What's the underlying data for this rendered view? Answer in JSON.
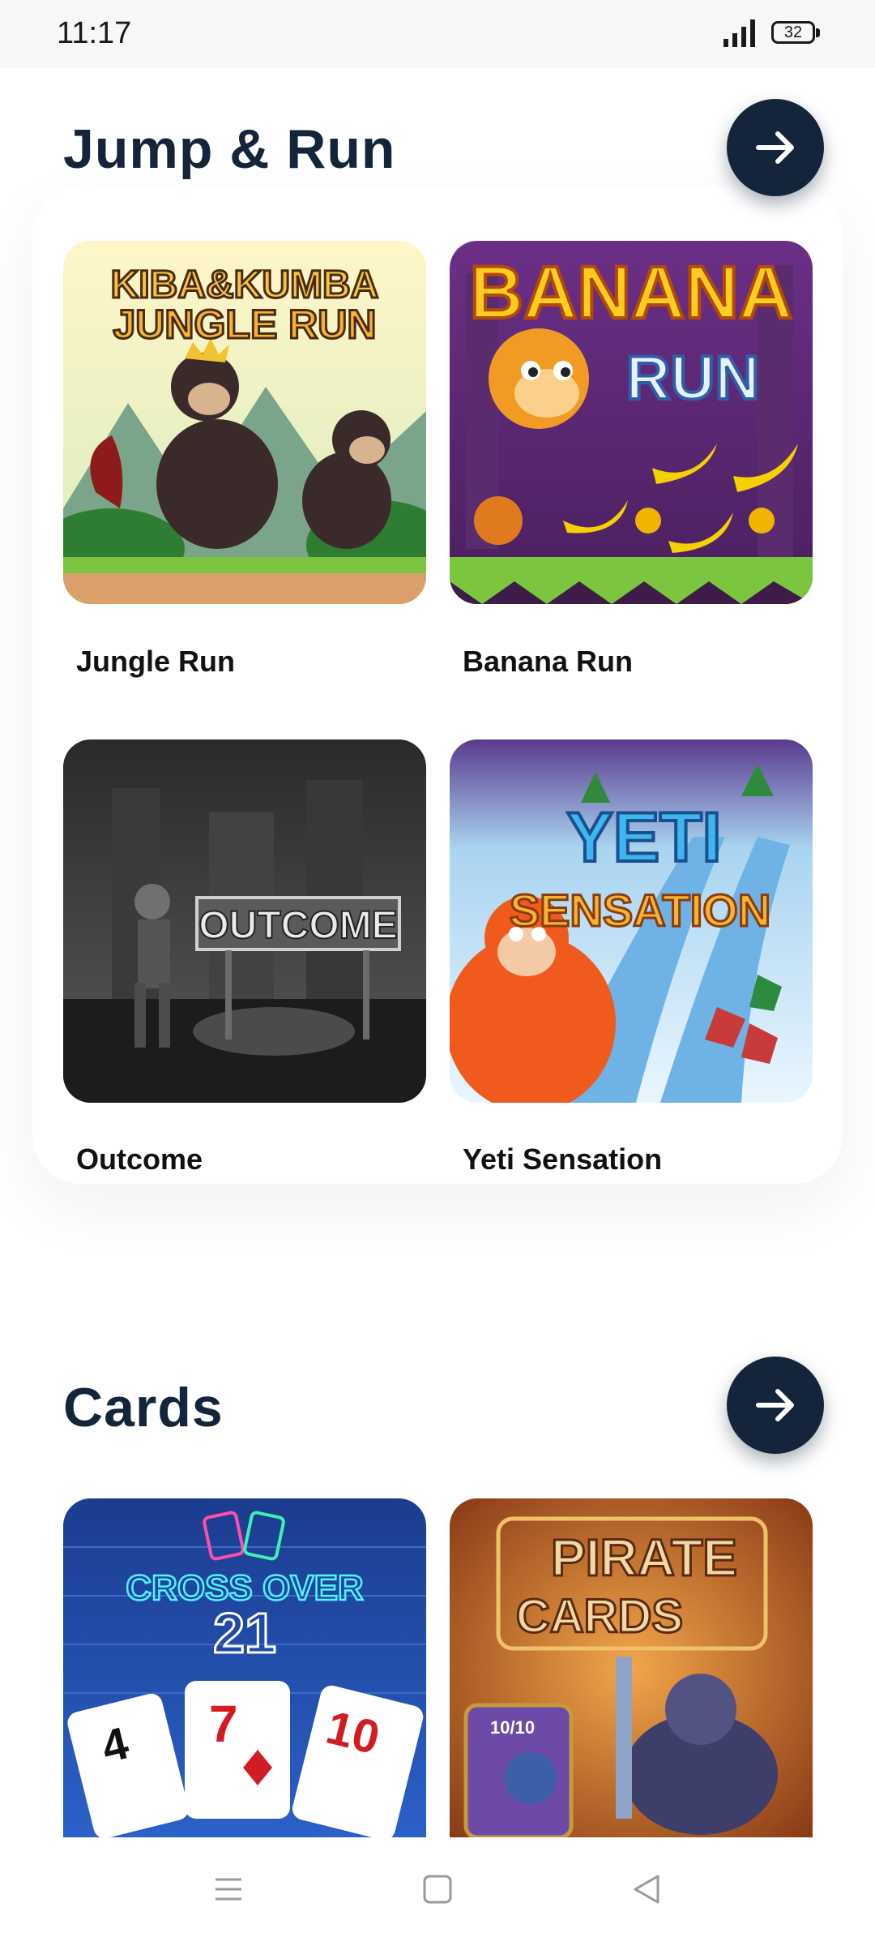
{
  "status_bar": {
    "time": "11:17",
    "battery_level": "32",
    "icons": [
      "signal-icon",
      "battery-icon"
    ]
  },
  "sections": [
    {
      "title": "Jump & Run",
      "games": [
        {
          "name": "Jungle Run",
          "art_text": [
            "KIBA&KUMBA",
            "JUNGLE RUN"
          ]
        },
        {
          "name": "Banana Run",
          "art_text": [
            "BANANA",
            "RUN"
          ]
        },
        {
          "name": "Outcome",
          "art_text": [
            "OUTCOME"
          ]
        },
        {
          "name": "Yeti Sensation",
          "art_text": [
            "YETI",
            "SENSATION"
          ]
        }
      ]
    },
    {
      "title": "Cards",
      "games": [
        {
          "name": "Crossover 21",
          "art_text": [
            "CROSS OVER",
            "21",
            "4",
            "7",
            "10"
          ]
        },
        {
          "name": "Pirate Cards",
          "art_text": [
            "PIRATE",
            "CARDS",
            "10/10"
          ]
        }
      ]
    }
  ],
  "nav_bar": {
    "icons": [
      "menu-icon",
      "home-square-icon",
      "back-triangle-icon"
    ]
  },
  "colors": {
    "title": "#14253b",
    "arrow_button": "#14253b",
    "background": "#ffffff"
  }
}
